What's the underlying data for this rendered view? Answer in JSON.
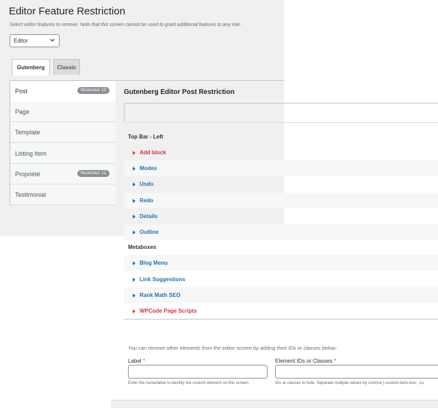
{
  "page": {
    "title": "Editor Feature Restriction",
    "description": "Select editor features to remove. Note that this screen cannot be used to grant additional features to any role."
  },
  "role_select": {
    "value": "Editor"
  },
  "tabs": [
    {
      "label": "Gutenberg"
    },
    {
      "label": "Classic"
    }
  ],
  "post_types": [
    {
      "label": "Post",
      "badge": "Restricted: 10"
    },
    {
      "label": "Page",
      "badge": ""
    },
    {
      "label": "Template",
      "badge": ""
    },
    {
      "label": "Listing Item",
      "badge": ""
    },
    {
      "label": "Propriété",
      "badge": "Restricted: 12"
    },
    {
      "label": "Testimonial",
      "badge": ""
    }
  ],
  "main": {
    "title": "Gutenberg Editor Post Restriction",
    "sections": [
      {
        "label": "Top Bar - Left",
        "items": [
          {
            "label": "Add block",
            "restricted": true
          },
          {
            "label": "Modes",
            "restricted": false
          },
          {
            "label": "Undo",
            "restricted": false
          },
          {
            "label": "Redo",
            "restricted": false
          },
          {
            "label": "Details",
            "restricted": false
          },
          {
            "label": "Outline",
            "restricted": false
          }
        ]
      },
      {
        "label": "Metaboxes",
        "items": [
          {
            "label": "Blog Menu",
            "restricted": false
          },
          {
            "label": "Link Suggestions",
            "restricted": false
          },
          {
            "label": "Rank Math SEO",
            "restricted": false
          },
          {
            "label": "WPCode Page Scripts",
            "restricted": true
          }
        ]
      }
    ]
  },
  "custom": {
    "note": "You can remove other elements from the editor screen by adding their IDs or classes below:",
    "label_field": {
      "label": "Label",
      "required": "*",
      "help": "Enter the name/label to identify the custom element on this screen."
    },
    "ids_field": {
      "label": "Element IDs or Classes",
      "required": "*",
      "help": "IDs or classes to hide. Separate multiple values by comma (.custom-item-one, .cu"
    }
  },
  "colors": {
    "link": "#2271b1",
    "restricted": "#d63638",
    "badge": "#8c8f94"
  }
}
